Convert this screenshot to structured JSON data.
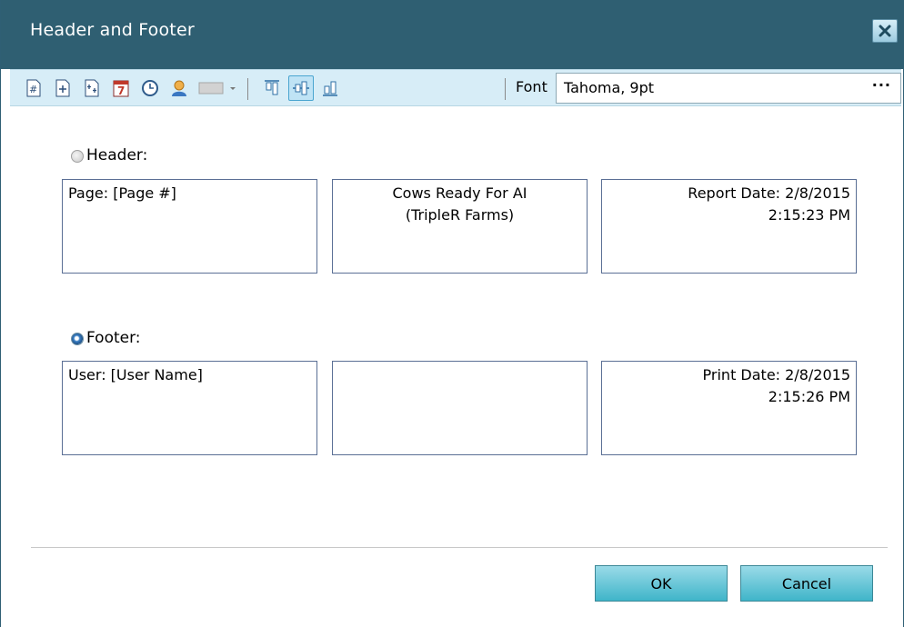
{
  "window": {
    "title": "Header and Footer"
  },
  "toolbar": {
    "font_label": "Font",
    "font_value": "Tahoma, 9pt",
    "font_more": "···",
    "icons": [
      "page-number-icon",
      "page-count-icon",
      "page-of-pages-icon",
      "date-icon",
      "time-icon",
      "user-name-icon",
      "image-icon",
      "dropdown-arrow-icon",
      "align-top-icon",
      "align-middle-icon",
      "align-bottom-icon"
    ]
  },
  "header": {
    "label": "Header:",
    "left": "Page: [Page #]",
    "center": "Cows Ready For AI\n(TripleR Farms)",
    "right": "Report Date: 2/8/2015\n2:15:23 PM"
  },
  "footer": {
    "label": "Footer:",
    "left": "User: [User Name]",
    "center": "",
    "right": "Print Date: 2/8/2015\n2:15:26 PM"
  },
  "buttons": {
    "ok": "OK",
    "cancel": "Cancel"
  },
  "colors": {
    "titlebar": "#2f5f72",
    "toolbar": "#d7edf7",
    "button": "#5cc4d6",
    "box_border": "#5a6f95"
  }
}
